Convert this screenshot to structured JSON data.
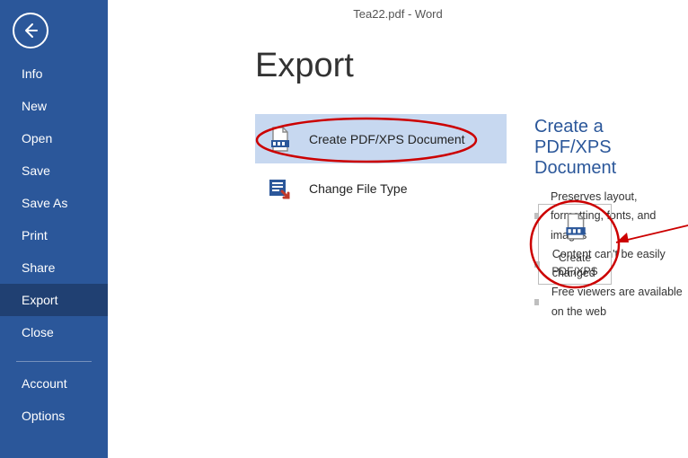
{
  "window_title": "Tea22.pdf - Word",
  "page_heading": "Export",
  "sidebar": {
    "items": [
      {
        "label": "Info"
      },
      {
        "label": "New"
      },
      {
        "label": "Open"
      },
      {
        "label": "Save"
      },
      {
        "label": "Save As"
      },
      {
        "label": "Print"
      },
      {
        "label": "Share"
      },
      {
        "label": "Export",
        "active": true
      },
      {
        "label": "Close"
      }
    ],
    "footer": [
      {
        "label": "Account"
      },
      {
        "label": "Options"
      }
    ]
  },
  "options": [
    {
      "label": "Create PDF/XPS Document",
      "icon": "document-pdf-icon",
      "selected": true
    },
    {
      "label": "Change File Type",
      "icon": "change-file-type-icon",
      "selected": false
    }
  ],
  "details": {
    "heading": "Create a PDF/XPS Document",
    "bullets": [
      "Preserves layout, formatting, fonts, and images",
      "Content can't be easily changed",
      "Free viewers are available on the web"
    ],
    "button": {
      "label_line1": "Create",
      "label_line2": "PDF/XPS",
      "icon": "document-pdf-icon"
    }
  },
  "colors": {
    "word_blue": "#2b579a",
    "selection_blue": "#c7d8f0",
    "annotation_red": "#cc0000"
  }
}
